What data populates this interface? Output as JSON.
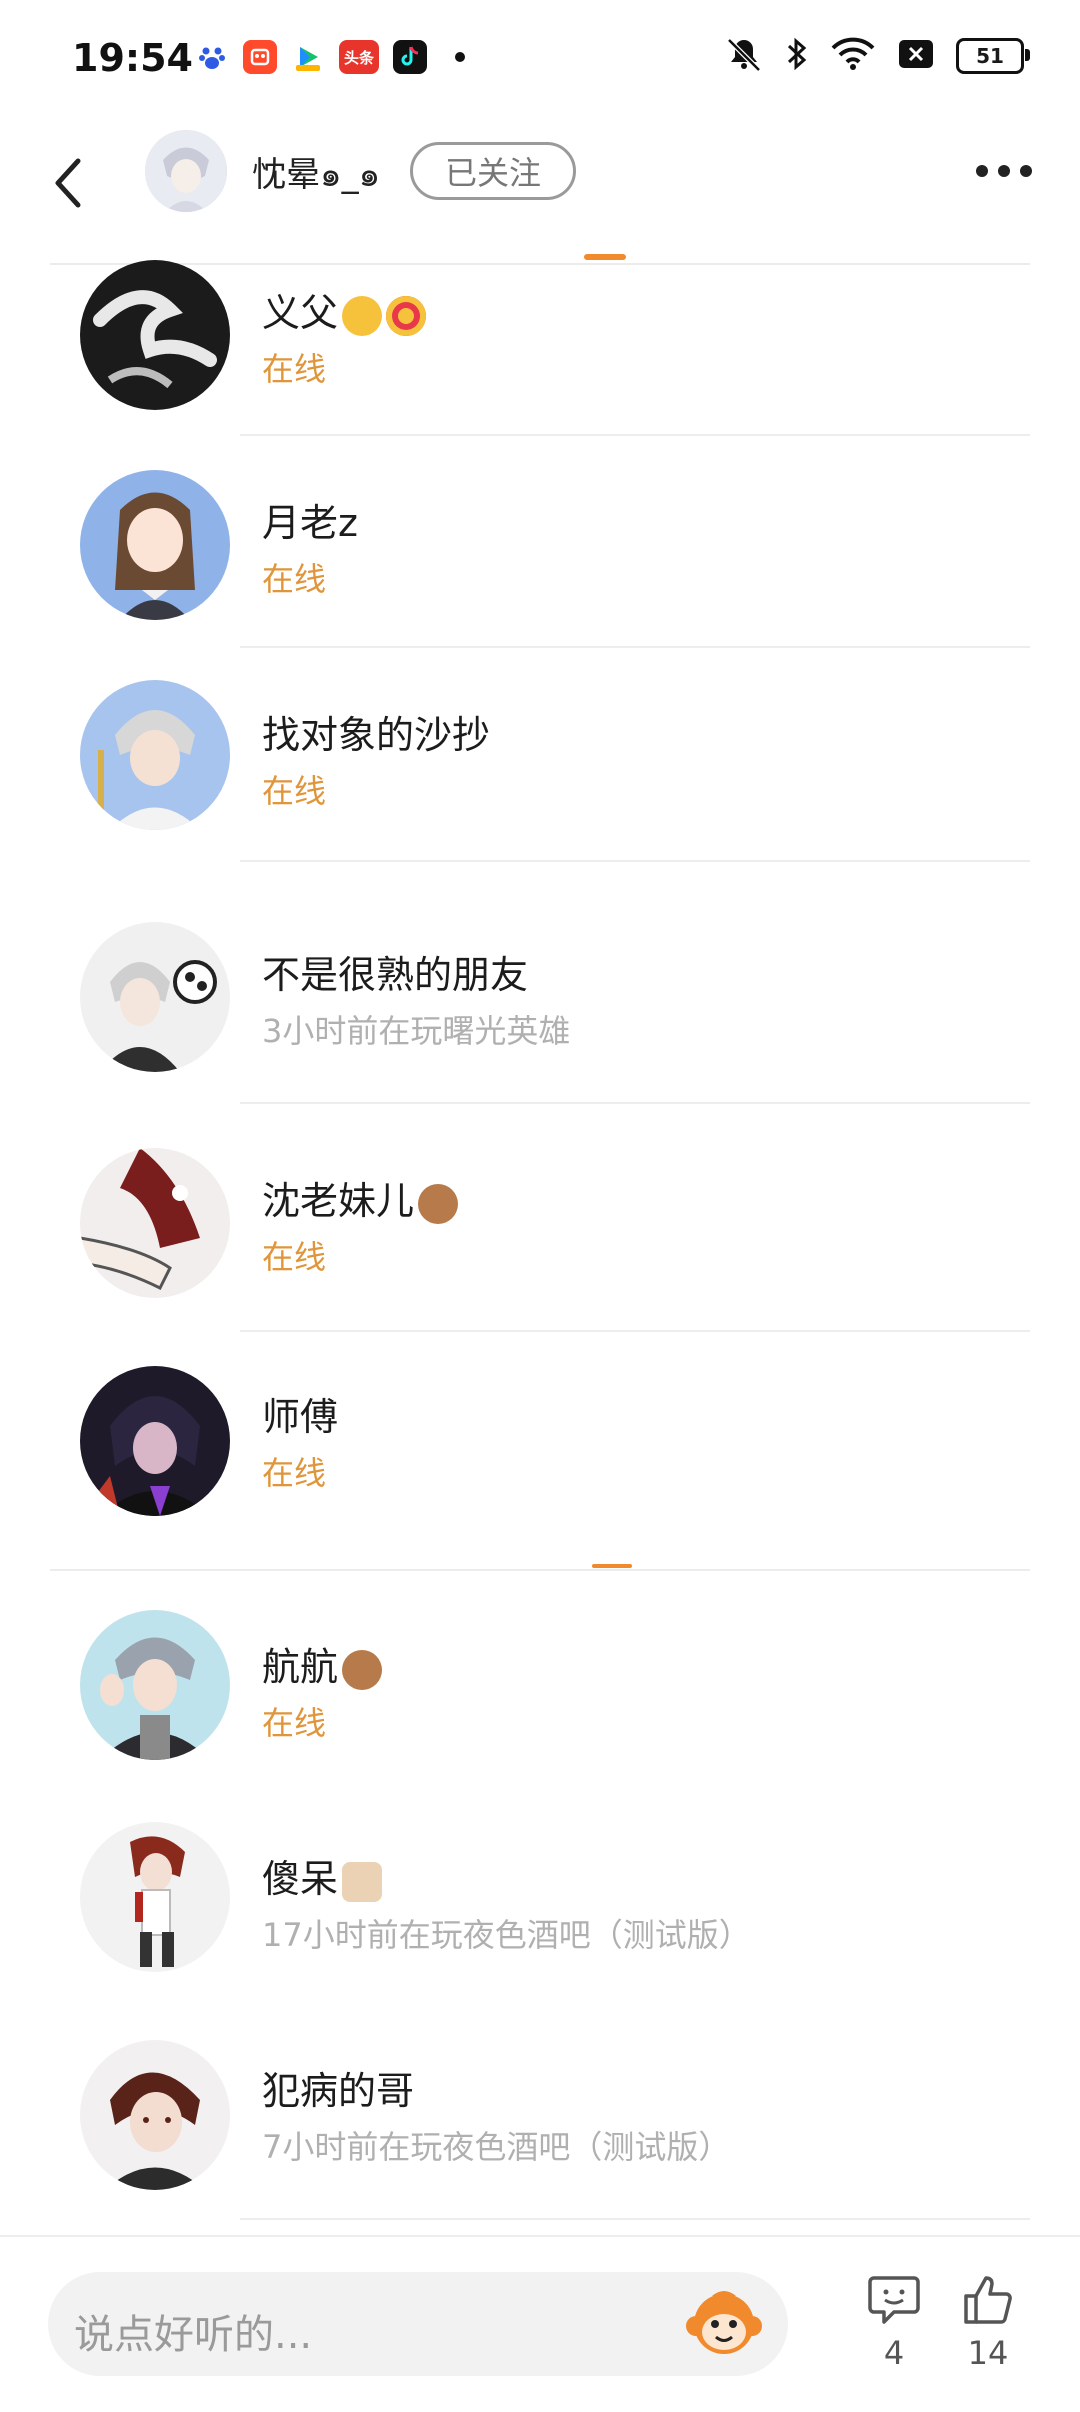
{
  "status_bar": {
    "time": "19:54",
    "battery": "51",
    "left_icons": [
      "baidu-icon",
      "kuaishou-icon",
      "video-app-icon",
      "toutiao-icon",
      "douyin-icon"
    ],
    "right_icons": [
      "mute-icon",
      "bluetooth-icon",
      "wifi-icon",
      "sim-icon"
    ],
    "toutiao_text": "头条"
  },
  "header": {
    "name": "忱晕๑_๑",
    "follow_label": "已关注"
  },
  "friends": [
    {
      "name": "义父",
      "status": "在线",
      "online": true
    },
    {
      "name": "月老z",
      "status": "在线",
      "online": true
    },
    {
      "name": "找对象的沙抄",
      "status": "在线",
      "online": true
    },
    {
      "name": "不是很熟的朋友",
      "status": "3小时前在玩曙光英雄",
      "online": false
    },
    {
      "name": "沈老妹儿",
      "status": "在线",
      "online": true
    },
    {
      "name": "师傅",
      "status": "在线",
      "online": true
    },
    {
      "name": "航航",
      "status": "在线",
      "online": true
    },
    {
      "name": "傻呆",
      "status": "17小时前在玩夜色酒吧（测试版）",
      "online": false
    },
    {
      "name": "犯病的哥",
      "status": "7小时前在玩夜色酒吧（测试版）",
      "online": false
    }
  ],
  "bottom": {
    "placeholder": "说点好听的...",
    "comment_count": "4",
    "like_count": "14"
  },
  "colors": {
    "accent": "#f08a2c",
    "online": "#e0953a",
    "offline": "#b0b0b0"
  }
}
